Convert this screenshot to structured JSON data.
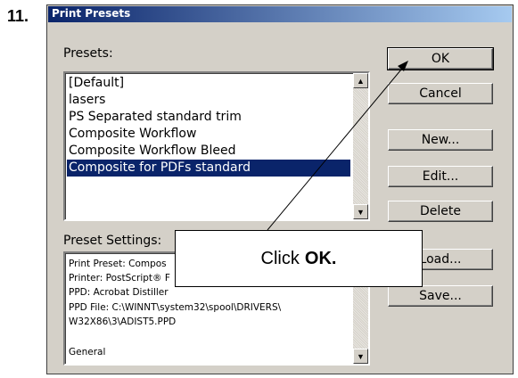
{
  "step": {
    "number": "11."
  },
  "window": {
    "title": "Print Presets"
  },
  "presets": {
    "label": "Presets:",
    "items": [
      "[Default]",
      "lasers",
      "PS Separated standard trim",
      "Composite Workflow",
      "Composite Workflow Bleed",
      "Composite for PDFs standard"
    ],
    "selected_index": 5
  },
  "buttons": {
    "ok": "OK",
    "cancel": "Cancel",
    "new": "New...",
    "edit": "Edit...",
    "delete": "Delete",
    "load": "Load...",
    "save": "Save..."
  },
  "preset_settings": {
    "label": "Preset Settings:",
    "lines": [
      "Print Preset: Compos",
      "Printer: PostScript® F",
      "PPD: Acrobat Distiller",
      "PPD File: C:\\WINNT\\system32\\spool\\DRIVERS\\",
      "W32X86\\3\\ADIST5.PPD",
      "",
      "General"
    ]
  },
  "callout": {
    "prefix": "Click",
    "emphasis": "OK."
  },
  "colors": {
    "selection": "#0a246a",
    "dialog_face": "#d4d0c8"
  }
}
